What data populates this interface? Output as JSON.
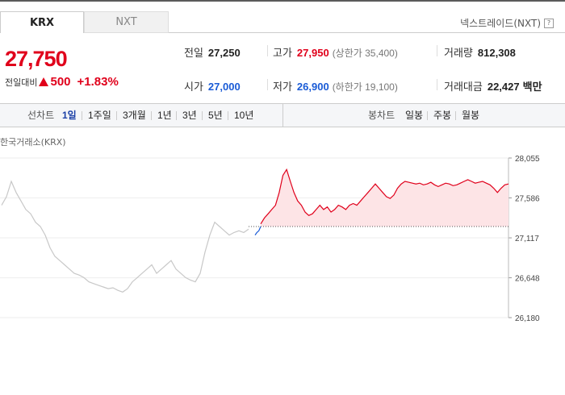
{
  "tabs": [
    {
      "label": "KRX",
      "active": true
    },
    {
      "label": "NXT",
      "active": false
    }
  ],
  "nxt_link": "넥스트레이드(NXT)",
  "help_icon": "question-icon",
  "price": {
    "current": "27,750",
    "change_label": "전일대비",
    "change_dir": "up",
    "change_amount": "500",
    "change_pct": "+1.83%"
  },
  "stats": {
    "prev_close": {
      "label": "전일",
      "value": "27,250"
    },
    "high": {
      "label": "고가",
      "value": "27,950",
      "sub": "(상한가 35,400)"
    },
    "volume": {
      "label": "거래량",
      "value": "812,308"
    },
    "open": {
      "label": "시가",
      "value": "27,000"
    },
    "low": {
      "label": "저가",
      "value": "26,900",
      "sub": "(하한가 19,100)"
    },
    "amount": {
      "label": "거래대금",
      "value": "22,427",
      "unit": "백만"
    }
  },
  "toolbar": {
    "line_label": "선차트",
    "line_periods": [
      "1일",
      "1주일",
      "3개월",
      "1년",
      "3년",
      "5년",
      "10년"
    ],
    "selected": "1일",
    "candle_label": "봉차트",
    "candle_periods": [
      "일봉",
      "주봉",
      "월봉"
    ]
  },
  "chart_title": "한국거래소(KRX)",
  "colors": {
    "up": "#e0001b",
    "down": "#1a5bd6",
    "prev_day": "#c8c8c8",
    "fill": "#fde4e6"
  },
  "chart_data": {
    "type": "line",
    "y_ticks": [
      "28,055",
      "27,586",
      "27,117",
      "26,648",
      "26,180"
    ],
    "ylim": [
      26180,
      28055
    ],
    "reference_price": 27250,
    "grid": true,
    "series": [
      {
        "values": [
          27500,
          27600,
          27780,
          27650,
          27550,
          27450,
          27400,
          27300,
          27250,
          27150,
          27000,
          26900,
          26850,
          26800,
          26750,
          26700,
          26680,
          26650,
          26600,
          26580,
          26560,
          26540,
          26520,
          26530,
          26500,
          26480,
          26520,
          26600,
          26650,
          26700,
          26750,
          26800,
          26700,
          26750,
          26800,
          26850,
          26750,
          26700,
          26650,
          26620,
          26600,
          26700,
          26950,
          27150,
          27300,
          27250,
          27200,
          27150,
          27180,
          27200,
          27180,
          27220
        ]
      },
      {
        "values": [
          27150,
          27180,
          27200,
          27250
        ]
      },
      {
        "values": [
          27280,
          27350,
          27400,
          27450,
          27500,
          27650,
          27850,
          27920,
          27780,
          27650,
          27550,
          27500,
          27420,
          27380,
          27400,
          27450,
          27500,
          27450,
          27480,
          27420,
          27450,
          27500,
          27480,
          27450,
          27500,
          27520,
          27500,
          27550,
          27600,
          27650,
          27700,
          27750,
          27700,
          27650,
          27600,
          27580,
          27620,
          27700,
          27750,
          27780,
          27770,
          27760,
          27750,
          27760,
          27740,
          27750,
          27770,
          27740,
          27720,
          27740,
          27760,
          27750,
          27730,
          27740,
          27760,
          27780,
          27800,
          27780,
          27760,
          27770,
          27780,
          27760,
          27740,
          27700,
          27650,
          27700,
          27740,
          27750
        ]
      }
    ]
  }
}
